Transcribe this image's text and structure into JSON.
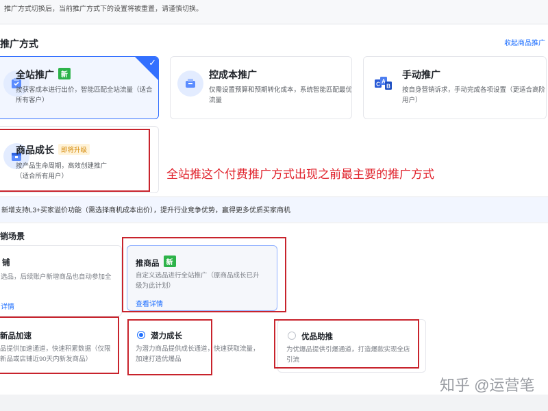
{
  "notice": "推广方式切换后，当前推广方式下的设置将被重置，请谨慎切换。",
  "promotion": {
    "section_title": "推广方式",
    "collapse_label": "收起商品推广",
    "cards": [
      {
        "title": "全站推广",
        "badge": "新",
        "desc": "按获客成本进行出价，智能匹配全站流量（适合所有客户）",
        "selected": true,
        "icon": "shield-bag-icon"
      },
      {
        "title": "控成本推广",
        "desc": "仅需设置预算和预期转化成本，系统智能匹配最优流量",
        "icon": "coin-bag-icon"
      },
      {
        "title": "手动推广",
        "desc": "按自身营销诉求，手动完成各项设置（更适合高阶用户）",
        "icon": "cab-letters-icon"
      },
      {
        "title": "商品成长",
        "badge": "即将升级",
        "desc": "按产品生命周期，高效创建推广（适合所有用户）",
        "icon": "growth-box-icon"
      }
    ]
  },
  "annotation": "全站推这个付费推广方式出现之前最主要的推广方式",
  "info_strip": "新增支持L3+买家溢价功能（需选择商机成本出价），提升行业竞争优势，赢得更多优质买家商机",
  "scenes": {
    "section_title": "销场景",
    "top_cards": [
      {
        "title": "铺",
        "desc_line1": "选品，后续账户新增商品也自动参加全",
        "desc_line2": "",
        "link": "详情"
      },
      {
        "title": "推商品",
        "badge": "新",
        "desc_line1": "自定义选品进行全站推广（原商品成长已升",
        "desc_line2": "级为此计划）",
        "link": "查看详情"
      }
    ],
    "sub_options": [
      {
        "title": "新品加速",
        "desc_line1": "品提供加速通道，快速积累数据（仅限",
        "desc_line2": "新品或店铺近90天内新发商品）"
      },
      {
        "title": "潜力成长",
        "desc_line1": "为潜力商品提供成长通道，快速获取流量，",
        "desc_line2": "加速打造优爆品",
        "selected": true
      },
      {
        "title": "优品助推",
        "desc_line1": "为优爆品提供引爆通道，打造爆款实现全店",
        "desc_line2": "引流"
      }
    ]
  },
  "watermark": "知乎 @运营笔",
  "colors": {
    "accent": "#3370ff",
    "annotation_red": "#e0202a",
    "new_badge": "#2db34a"
  }
}
